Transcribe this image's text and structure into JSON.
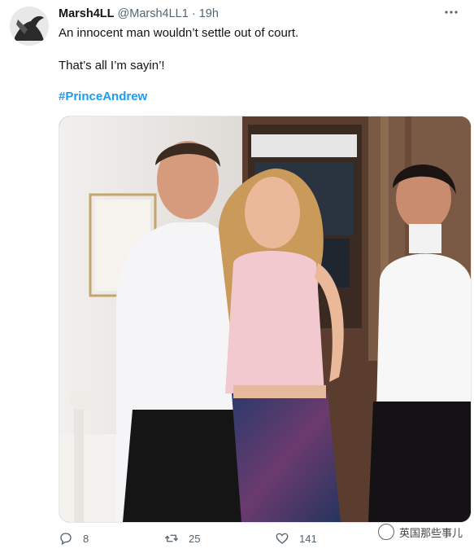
{
  "tweet": {
    "display_name": "Marsh4LL",
    "handle": "@Marsh4LL1",
    "separator": "·",
    "time": "19h",
    "line1": "An innocent man wouldn’t settle out of court.",
    "line2": "That’s all I’m sayin’!",
    "hashtag": "#PrinceAndrew",
    "avatar_icon": "avatar-photo",
    "more_icon": "more-horizontal-icon"
  },
  "actions": {
    "replies": "8",
    "retweets": "25",
    "likes": "141",
    "share_icon": "share-icon"
  },
  "watermark": {
    "text": "英国那些事儿",
    "icon": "wechat-icon"
  },
  "colors": {
    "link": "#1d9bf0",
    "secondary": "#536471",
    "primary_text": "#0f1419"
  }
}
